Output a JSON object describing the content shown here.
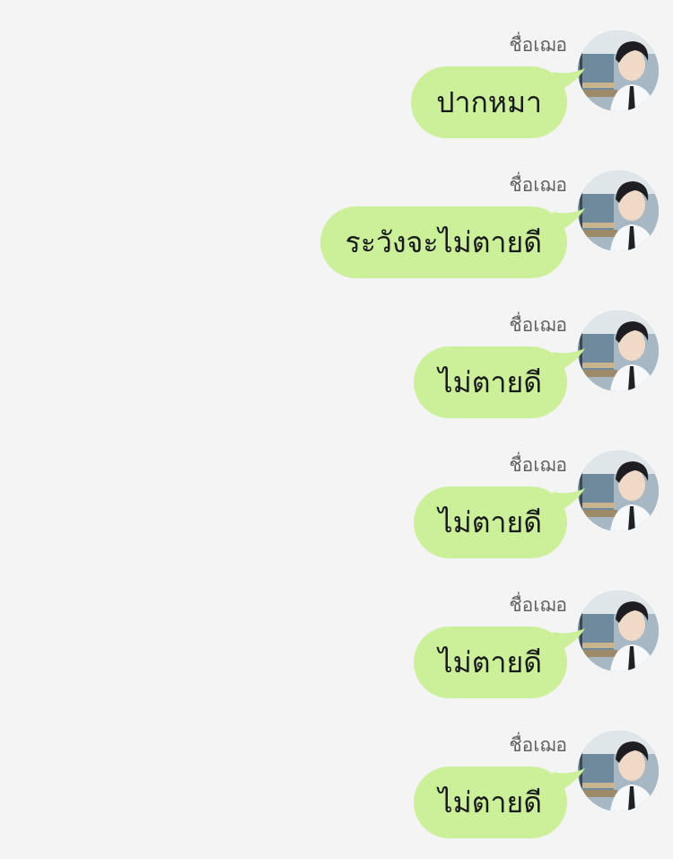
{
  "messages": [
    {
      "sender": "ชื่อเฌอ",
      "text": "ปากหมา"
    },
    {
      "sender": "ชื่อเฌอ",
      "text": "ระวังจะไม่ตายดี"
    },
    {
      "sender": "ชื่อเฌอ",
      "text": "ไม่ตายดี"
    },
    {
      "sender": "ชื่อเฌอ",
      "text": "ไม่ตายดี"
    },
    {
      "sender": "ชื่อเฌอ",
      "text": "ไม่ตายดี"
    },
    {
      "sender": "ชื่อเฌอ",
      "text": "ไม่ตายดี"
    }
  ],
  "colors": {
    "background": "#f4f4f4",
    "bubble": "#ccf09a",
    "sender_text": "#5f5f5f",
    "message_text": "#1a1a1a"
  },
  "icons": {
    "avatar": "profile-photo-avatar"
  }
}
